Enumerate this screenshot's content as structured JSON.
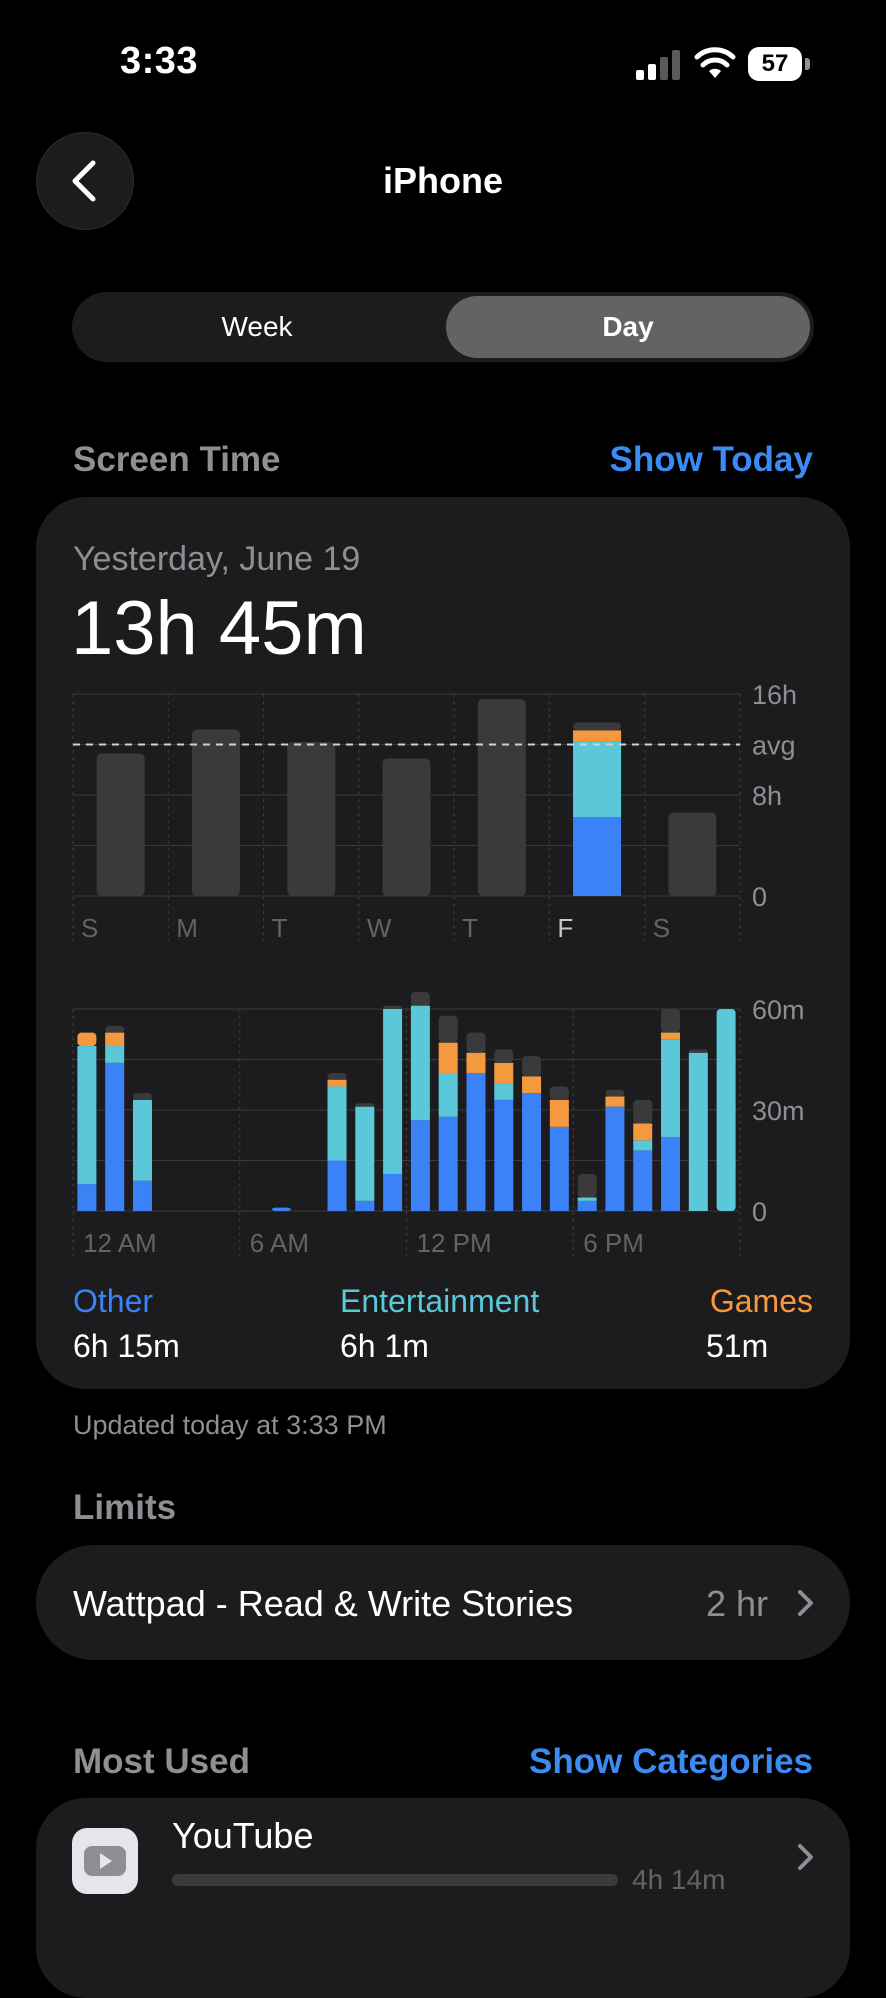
{
  "status": {
    "time": "3:33",
    "battery": "57"
  },
  "nav": {
    "title": "iPhone"
  },
  "segment": {
    "week": "Week",
    "day": "Day",
    "selected": "Day"
  },
  "screen_time": {
    "heading": "Screen Time",
    "show_today": "Show Today",
    "date": "Yesterday, June 19",
    "total": "13h 45m",
    "updated": "Updated today at 3:33 PM"
  },
  "legend": [
    {
      "name": "Other",
      "value": "6h 15m",
      "color": "#3b82f6"
    },
    {
      "name": "Entertainment",
      "value": "6h 1m",
      "color": "#5ac8d8"
    },
    {
      "name": "Games",
      "value": "51m",
      "color": "#f5993e"
    }
  ],
  "limits": {
    "heading": "Limits",
    "items": [
      {
        "name": "Wattpad - Read & Write Stories",
        "value": "2 hr"
      }
    ]
  },
  "most_used": {
    "heading": "Most Used",
    "show_categories": "Show Categories",
    "items": [
      {
        "name": "YouTube",
        "value": "4h 14m",
        "icon": "youtube-icon"
      }
    ]
  },
  "chart_data": [
    {
      "type": "bar",
      "categories": [
        "S",
        "M",
        "T",
        "W",
        "T",
        "F",
        "S"
      ],
      "y_ticks": [
        "0",
        "8h",
        "16h"
      ],
      "avg_label": "avg",
      "avg_hours": 12,
      "ylim": [
        0,
        16
      ],
      "total_hours": [
        11.3,
        13.2,
        12.2,
        10.9,
        15.6,
        13.75,
        6.6
      ],
      "highlight_index": 5,
      "highlight_breakdown": {
        "Other": 6.25,
        "Entertainment": 6.02,
        "Games": 0.85,
        "Uncategorized": 0.63
      },
      "colors": {
        "default": "#3a3a3c",
        "Uncategorized": "#3a3a3c"
      }
    },
    {
      "type": "bar",
      "stacked": true,
      "x_labels": [
        "12 AM",
        "6 AM",
        "12 PM",
        "6 PM"
      ],
      "y_ticks": [
        "0",
        "30m",
        "60m"
      ],
      "ylim": [
        0,
        60
      ],
      "hours": [
        0,
        1,
        2,
        3,
        4,
        5,
        6,
        7,
        8,
        9,
        10,
        11,
        12,
        13,
        14,
        15,
        16,
        17,
        18,
        19,
        20,
        21,
        22,
        23
      ],
      "series": [
        {
          "name": "Other",
          "values": [
            8,
            44,
            9,
            0,
            0,
            0,
            0,
            1,
            0,
            15,
            3,
            11,
            27,
            28,
            41,
            33,
            35,
            25,
            3,
            31,
            18,
            22,
            0,
            0
          ]
        },
        {
          "name": "Entertainment",
          "values": [
            41,
            5,
            24,
            0,
            0,
            0,
            0,
            0,
            0,
            22,
            28,
            49,
            34,
            13,
            0,
            5,
            0,
            0,
            1,
            0,
            3,
            29,
            47,
            60
          ]
        },
        {
          "name": "Games",
          "values": [
            4,
            4,
            0,
            0,
            0,
            0,
            0,
            0,
            0,
            2,
            0,
            0,
            0,
            9,
            6,
            6,
            5,
            8,
            0,
            3,
            5,
            2,
            0,
            0
          ]
        },
        {
          "name": "Uncategorized",
          "values": [
            0,
            2,
            2,
            0,
            0,
            0,
            0,
            0,
            0,
            2,
            1,
            1,
            4,
            8,
            6,
            4,
            6,
            4,
            7,
            2,
            7,
            7,
            1,
            0
          ]
        }
      ]
    }
  ]
}
